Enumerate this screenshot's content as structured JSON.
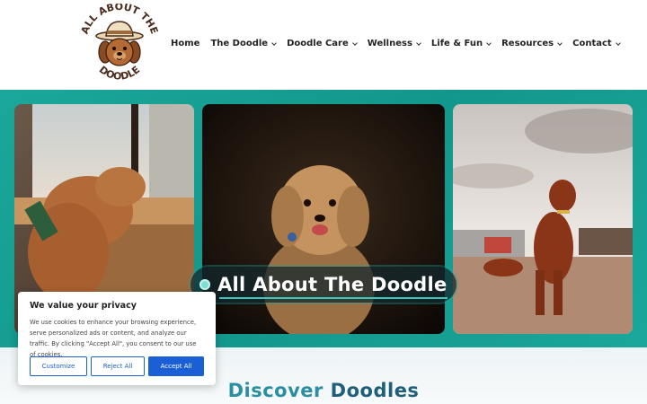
{
  "logo": {
    "line1": "ALL ABOUT THE",
    "line2": "DOODLE"
  },
  "nav": {
    "items": [
      {
        "label": "Home",
        "dropdown": false
      },
      {
        "label": "The Doodle",
        "dropdown": true
      },
      {
        "label": "Doodle Care",
        "dropdown": true
      },
      {
        "label": "Wellness",
        "dropdown": true
      },
      {
        "label": "Life & Fun",
        "dropdown": true
      },
      {
        "label": "Resources",
        "dropdown": true
      },
      {
        "label": "Contact",
        "dropdown": true
      }
    ]
  },
  "hero": {
    "title": "All About The Doodle",
    "background_color": "#17a093"
  },
  "section": {
    "title_part1": "Discover",
    "title_part2": "Doodles"
  },
  "cookie_banner": {
    "title": "We value your privacy",
    "text": "We use cookies to enhance your browsing experience, serve personalized ads or content, and analyze our traffic. By clicking \"Accept All\", you consent to our use of cookies.",
    "customize_label": "Customize",
    "reject_label": "Reject All",
    "accept_label": "Accept All",
    "accent_color": "#1b5fd6"
  }
}
